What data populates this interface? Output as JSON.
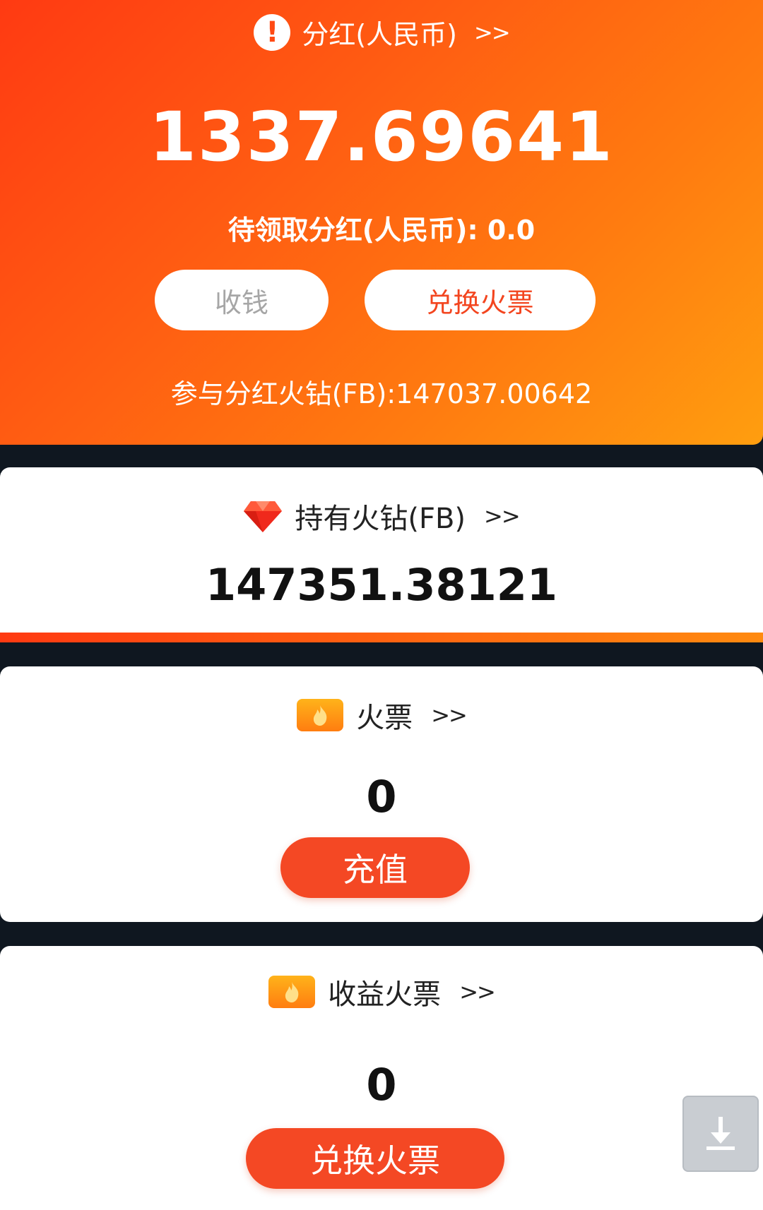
{
  "dividend": {
    "title": "分红(人民币)",
    "chevron": ">>",
    "amount": "1337.69641",
    "pending_label": "待领取分红(人民币): 0.0",
    "collect_button": "收钱",
    "exchange_button": "兑换火票",
    "fb_participation": "参与分红火钻(FB):147037.00642"
  },
  "holdings": {
    "title": "持有火钻(FB)",
    "chevron": ">>",
    "amount": "147351.38121"
  },
  "tickets": {
    "title": "火票",
    "chevron": ">>",
    "amount": "0",
    "recharge_button": "充值"
  },
  "earnings_tickets": {
    "title": "收益火票",
    "chevron": ">>",
    "amount": "0",
    "exchange_button": "兑换火票"
  },
  "colors": {
    "accent_red": "#f44824",
    "gradient_start": "#ff3a12",
    "gradient_end": "#ff9e0f",
    "dark_background": "#0f1720"
  },
  "icons": {
    "dividend": "alert-icon",
    "holdings": "diamond-icon",
    "tickets": "fire-ticket-icon",
    "earnings": "fire-ticket-icon",
    "download": "download-icon"
  }
}
